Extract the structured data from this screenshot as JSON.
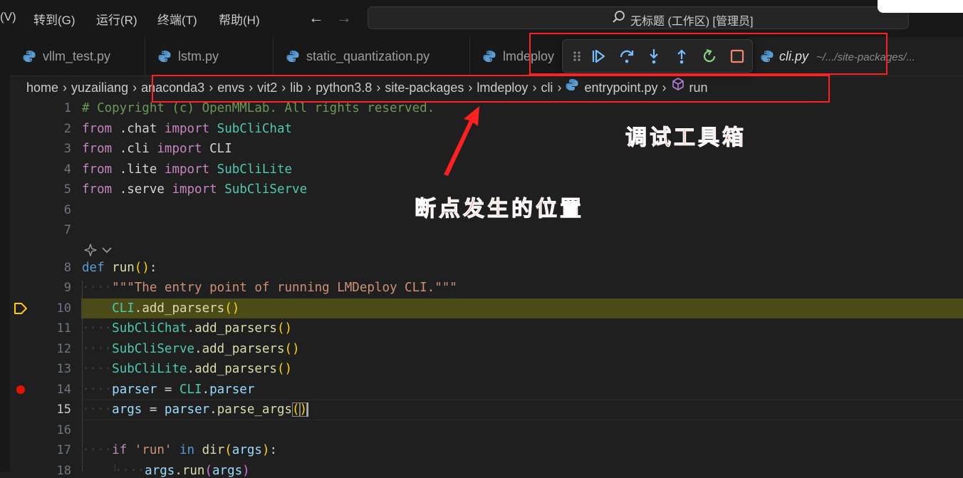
{
  "menu": {
    "items": [
      "(V)",
      "转到(G)",
      "运行(R)",
      "终端(T)",
      "帮助(H)"
    ],
    "search_text": "无标题 (工作区) [管理员]"
  },
  "tabs": [
    {
      "label": "vllm_test.py"
    },
    {
      "label": "lstm.py"
    },
    {
      "label": "static_quantization.py"
    },
    {
      "label": "lmdeploy"
    },
    {
      "label": "cli.py",
      "description": "~/.../site-packages/..."
    }
  ],
  "debug_toolbar": {
    "icons": [
      "drag-handle-icon",
      "continue-icon",
      "step-over-icon",
      "step-into-icon",
      "step-out-icon",
      "restart-icon",
      "stop-icon"
    ],
    "colors": {
      "accent": "#75beff",
      "restart": "#89d185",
      "stop": "#f48771"
    }
  },
  "breadcrumb": [
    "home",
    "yuzailiang",
    "anaconda3",
    "envs",
    "vit2",
    "lib",
    "python3.8",
    "site-packages",
    "lmdeploy",
    "cli",
    "entrypoint.py",
    "run"
  ],
  "editor": {
    "line_numbers": [
      "1",
      "2",
      "3",
      "4",
      "5",
      "6",
      "7",
      "8",
      "9",
      "10",
      "11",
      "12",
      "13",
      "14",
      "15",
      "16",
      "17",
      "18"
    ],
    "current_line": "15",
    "paused_line": "10",
    "breakpoint_line": "14",
    "lines": {
      "l1": "# Copyright (c) OpenMMLab. All rights reserved.",
      "l2": [
        "from",
        " .chat ",
        "import",
        " SubCliChat"
      ],
      "l3": [
        "from",
        " .cli ",
        "import",
        " CLI"
      ],
      "l4": [
        "from",
        " .lite ",
        "import",
        " SubCliLite"
      ],
      "l5": [
        "from",
        " .serve ",
        "import",
        " SubCliServe"
      ],
      "l8": [
        "def",
        " ",
        "run",
        "(",
        ")",
        ":"
      ],
      "l9": "\"\"\"The entry point of running LMDeploy CLI.\"\"\"",
      "l10": [
        "CLI",
        ".",
        "add_parsers",
        "(",
        ")"
      ],
      "l11": [
        "SubCliChat",
        ".",
        "add_parsers",
        "(",
        ")"
      ],
      "l12": [
        "SubCliServe",
        ".",
        "add_parsers",
        "(",
        ")"
      ],
      "l13": [
        "SubCliLite",
        ".",
        "add_parsers",
        "(",
        ")"
      ],
      "l14": [
        "parser",
        " = ",
        "CLI",
        ".",
        "parser"
      ],
      "l15": [
        "args",
        " = ",
        "parser",
        ".",
        "parse_args",
        "(",
        ")"
      ],
      "l17": [
        "if",
        " ",
        "'run'",
        " ",
        "in",
        " ",
        "dir",
        "(",
        "args",
        ")",
        ":"
      ],
      "l18": [
        "args",
        ".",
        "run",
        "(",
        "args",
        ")"
      ]
    },
    "indent_dots": "····"
  },
  "annotations": {
    "toolbox_label": "调试工具箱",
    "breakpoint_label": "断点发生的位置",
    "color": "#ff2020"
  }
}
